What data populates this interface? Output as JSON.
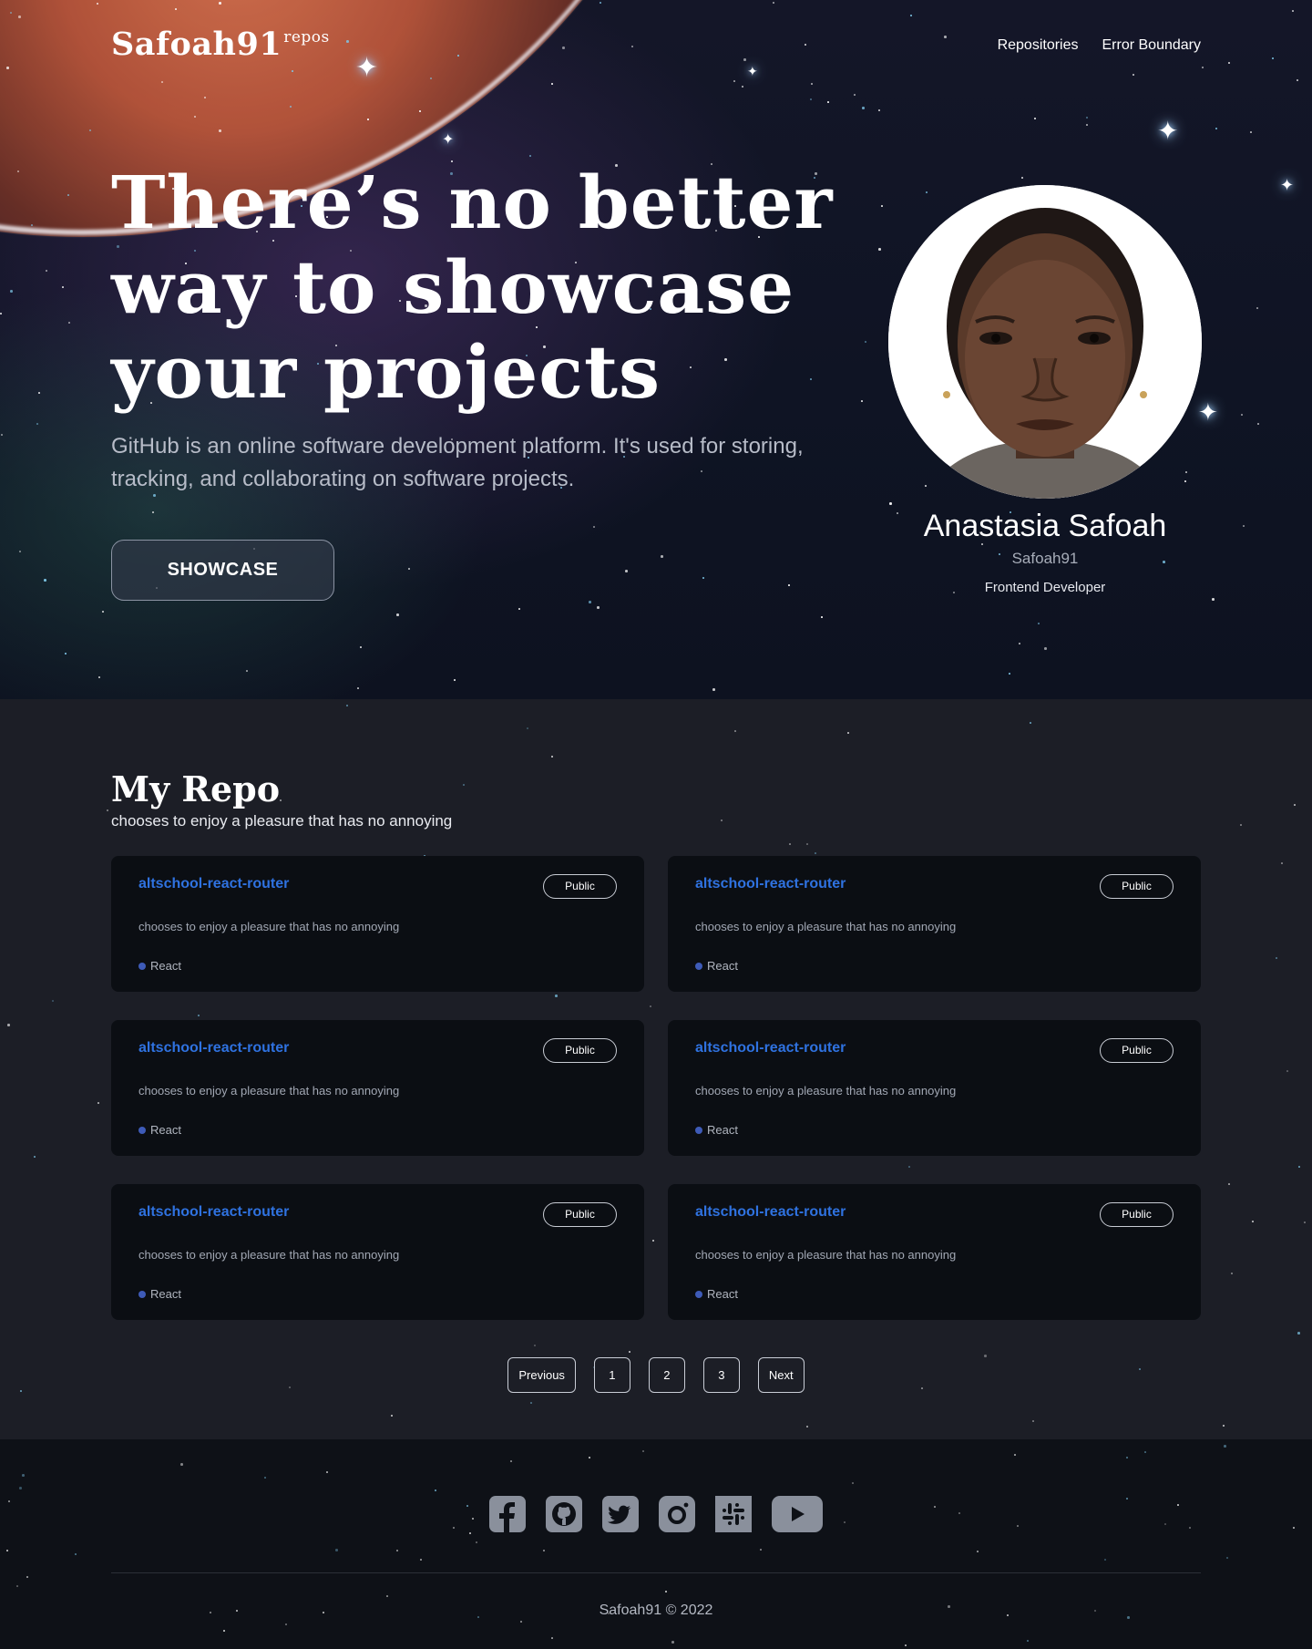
{
  "header": {
    "brand": "Safoah91",
    "brand_sup": "repos",
    "nav": [
      "Repositories",
      "Error Boundary"
    ]
  },
  "hero": {
    "headline": "There’s no better way to showcase your projects",
    "lead": "GitHub is an online software development platform. It's used for storing, tracking, and collaborating on software projects.",
    "button": "SHOWCASE"
  },
  "profile": {
    "name": "Anastasia Safoah",
    "username": "Safoah91",
    "role": "Frontend Developer"
  },
  "repos": {
    "title": "My Repo",
    "subtitle": "chooses to enjoy a pleasure that has no annoying",
    "cards": [
      {
        "title": "altschool-react-router",
        "badge": "Public",
        "desc": "chooses to enjoy a pleasure that has no annoying",
        "lang": "React"
      },
      {
        "title": "altschool-react-router",
        "badge": "Public",
        "desc": "chooses to enjoy a pleasure that has no annoying",
        "lang": "React"
      },
      {
        "title": "altschool-react-router",
        "badge": "Public",
        "desc": "chooses to enjoy a pleasure that has no annoying",
        "lang": "React"
      },
      {
        "title": "altschool-react-router",
        "badge": "Public",
        "desc": "chooses to enjoy a pleasure that has no annoying",
        "lang": "React"
      },
      {
        "title": "altschool-react-router",
        "badge": "Public",
        "desc": "chooses to enjoy a pleasure that has no annoying",
        "lang": "React"
      },
      {
        "title": "altschool-react-router",
        "badge": "Public",
        "desc": "chooses to enjoy a pleasure that has no annoying",
        "lang": "React"
      }
    ]
  },
  "pagination": {
    "previous": "Previous",
    "pages": [
      "1",
      "2",
      "3"
    ],
    "next": "Next"
  },
  "footer": {
    "socials": [
      "facebook-icon",
      "github-icon",
      "twitter-icon",
      "instagram-icon",
      "slack-icon",
      "youtube-icon"
    ],
    "copyright": "Safoah91 © 2022"
  },
  "colors": {
    "repo_link": "#2f72e0",
    "lang_dot": "#3e5bb8",
    "card_bg": "#0b0e13",
    "section_bg": "#1c1e26",
    "icon_fill": "#8a909c"
  }
}
